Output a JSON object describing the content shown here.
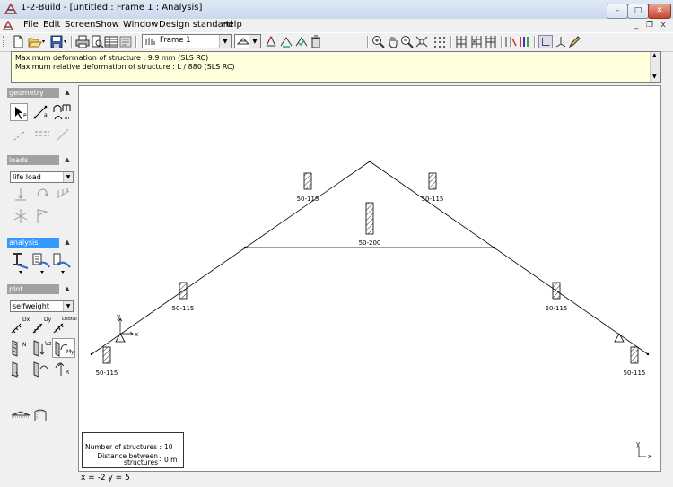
{
  "window": {
    "title": "1-2-Build - [untitled : Frame 1 : Analysis]",
    "min_glyph": "–",
    "max_glyph": "□",
    "close_glyph": "✕"
  },
  "menu": {
    "items": [
      "File",
      "Edit",
      "Screen",
      "Show",
      "Window",
      "Design standard",
      "Help"
    ],
    "mdi_min": "_",
    "mdi_restore": "❐",
    "mdi_close": "x"
  },
  "toolbar": {
    "frame_select": "Frame 1"
  },
  "messages": [
    "Maximum deformation of structure : 9.9 mm (SLS RC)",
    "Maximum relative deformation of structure : L / 880 (SLS RC)"
  ],
  "left_panel": {
    "geometry": "geometry",
    "loads": "loads",
    "loads_select": "life load",
    "analysis": "analysis",
    "plot": "plot",
    "plot_select": "selfweight",
    "sublabels": {
      "p": "P",
      "a": "a",
      "dx": "Dx",
      "dy": "Dy",
      "dtotal": "Dtotal",
      "n": "N",
      "vz": "Vz",
      "my": "My",
      "r": "R"
    }
  },
  "canvas": {
    "members": [
      {
        "label": "50-115"
      },
      {
        "label": "50-115"
      },
      {
        "label": "50-200"
      },
      {
        "label": "50-115"
      },
      {
        "label": "50-115"
      },
      {
        "label": "50-115"
      },
      {
        "label": "50-115"
      }
    ],
    "axis_x": "x",
    "axis_y": "y",
    "num_structures_label": "Number of structures :",
    "num_structures_value": "10",
    "distance_label_1": "Distance between",
    "distance_label_2": "structures",
    "distance_colon": ":",
    "distance_value": "0 m"
  },
  "status": {
    "coords": "x = -2 y = 5"
  },
  "colors": {
    "active_section": "#3399ff",
    "inactive_section": "#a0a0a0",
    "message_bg": "#ffffdc"
  }
}
